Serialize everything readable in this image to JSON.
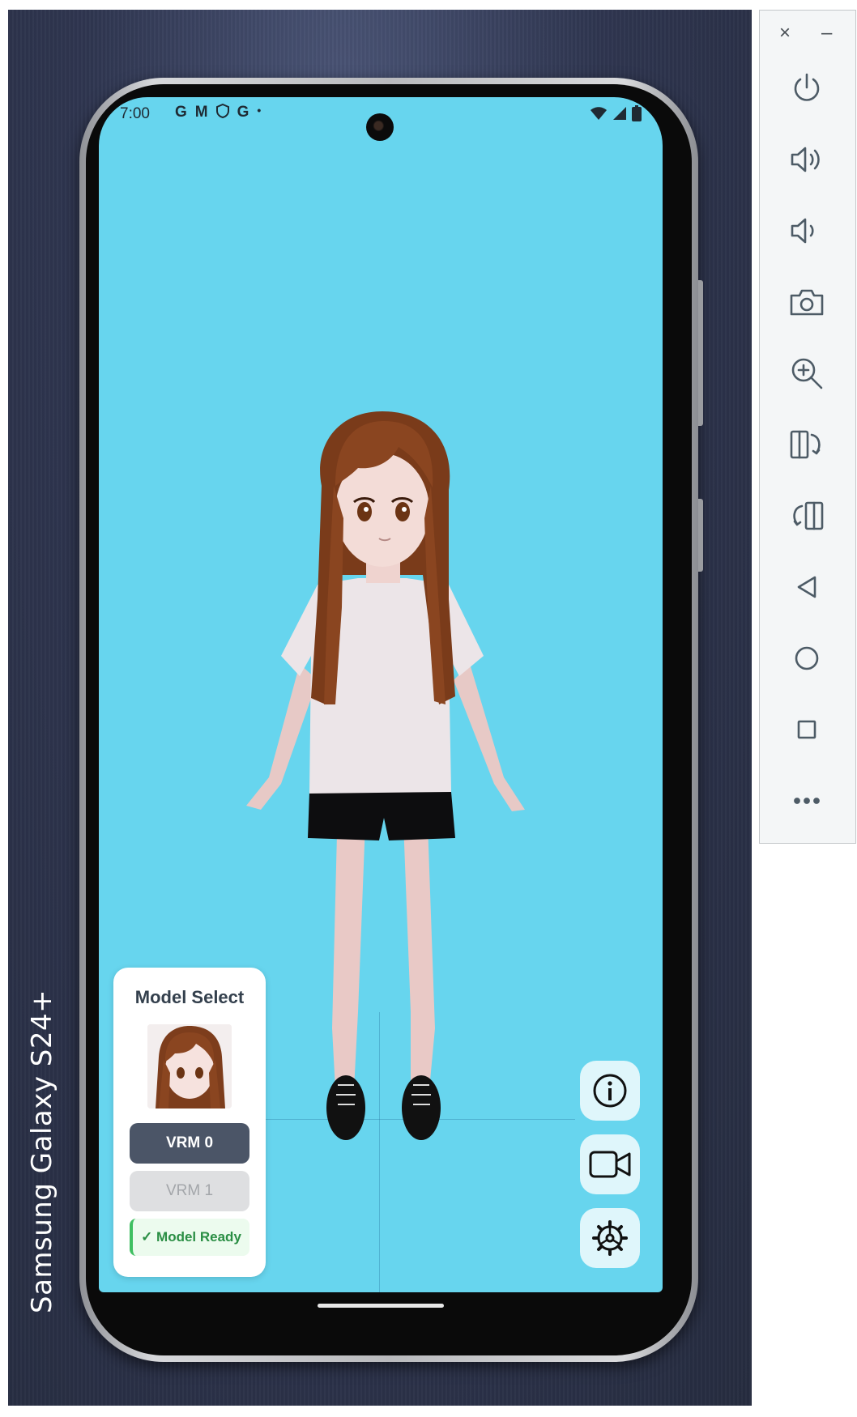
{
  "device": {
    "brand_label": "Samsung Galaxy  S24+"
  },
  "status_bar": {
    "time": "7:00",
    "icons": [
      "google-icon",
      "gmail-icon",
      "shield-icon",
      "google-icon",
      "dot-icon"
    ],
    "right_icons": [
      "wifi-icon",
      "signal-icon",
      "battery-icon"
    ]
  },
  "model_panel": {
    "title": "Model Select",
    "buttons": [
      {
        "label": "VRM 0",
        "selected": true
      },
      {
        "label": "VRM 1",
        "selected": false
      }
    ],
    "status": "✓ Model Ready"
  },
  "fab_buttons": [
    "info-icon",
    "video-camera-icon",
    "settings-gear-icon"
  ],
  "colors": {
    "screen_bg": "#67d5ee",
    "selected_button": "#4b5567",
    "ready_accent": "#3fbf61"
  },
  "emulator_toolbar": {
    "top_controls": [
      "×",
      "–"
    ],
    "buttons": [
      "power-icon",
      "volume-up-icon",
      "volume-down-icon",
      "camera-icon",
      "zoom-in-icon",
      "rotate-left-icon",
      "rotate-right-icon",
      "back-icon",
      "home-icon",
      "overview-icon",
      "more-icon"
    ]
  }
}
